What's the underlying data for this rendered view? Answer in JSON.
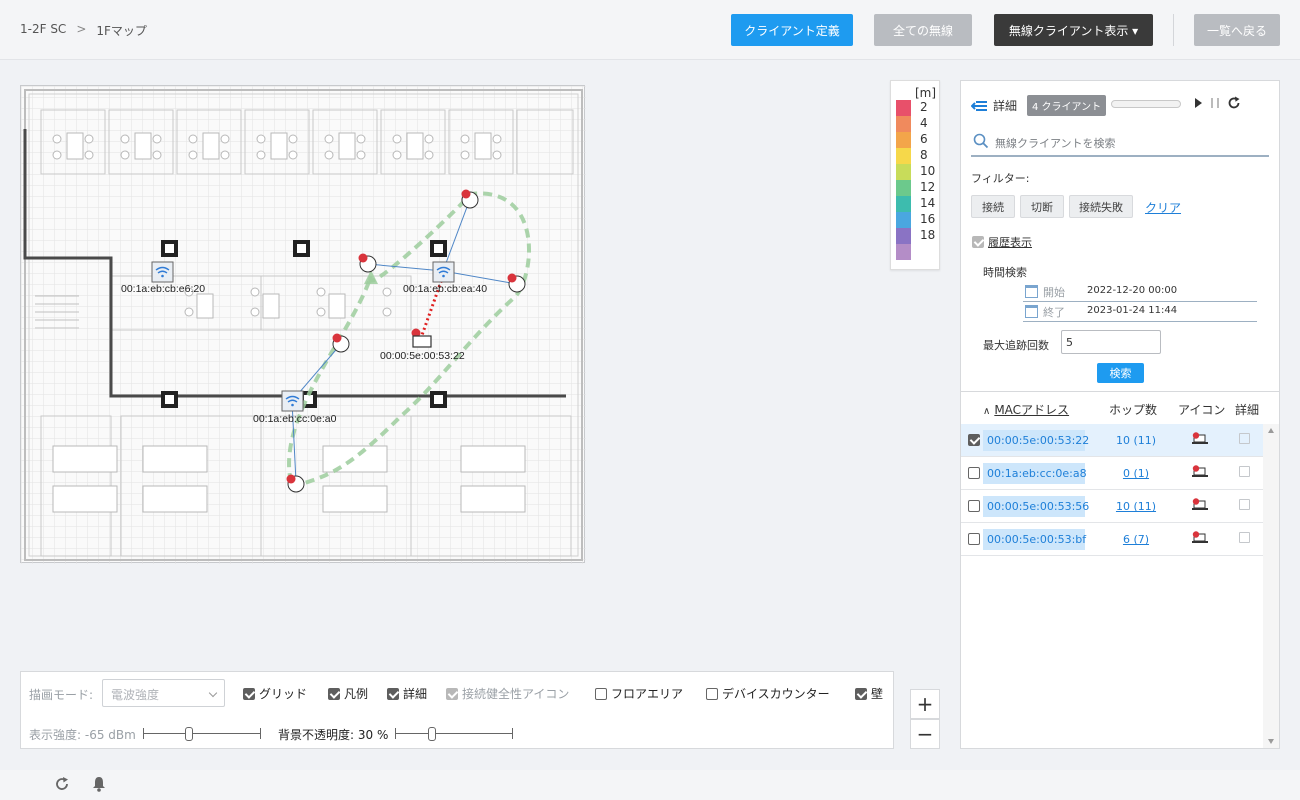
{
  "breadcrumb": {
    "root": "1-2F SC",
    "separator": ">",
    "current": "1Fマップ"
  },
  "header": {
    "define_client": "クライアント定義",
    "all_wireless": "全ての無線",
    "wireless_display": "無線クライアント表示 ▾",
    "back_to_list": "一覧へ戻る"
  },
  "legend": {
    "unit": "[m]",
    "items": [
      {
        "label": "2",
        "color": "#e8506a"
      },
      {
        "label": "4",
        "color": "#f08a5d"
      },
      {
        "label": "6",
        "color": "#f3a54a"
      },
      {
        "label": "8",
        "color": "#f6d84a"
      },
      {
        "label": "10",
        "color": "#c8dc5a"
      },
      {
        "label": "12",
        "color": "#6cc98c"
      },
      {
        "label": "14",
        "color": "#3dbcae"
      },
      {
        "label": "16",
        "color": "#4aa7e0"
      },
      {
        "label": "18",
        "color": "#8a73c4"
      },
      {
        "label": "",
        "color": "#b48dc7"
      }
    ]
  },
  "map": {
    "aps": [
      {
        "label": "00:1a:eb:cb:e6:20"
      },
      {
        "label": "00:1a:eb:cb:ea:40"
      },
      {
        "label": "00:1a:eb:cc:0e:a0"
      }
    ],
    "client_label": "00:00:5e:00:53:22"
  },
  "panel": {
    "detail": "詳細",
    "client_count": "4 クライアント",
    "search_placeholder": "無線クライアントを検索",
    "filter_label": "フィルター:",
    "filters": [
      "接続",
      "切断",
      "接続失敗"
    ],
    "clear": "クリア",
    "history": "履歴表示",
    "time_search": "時間検索",
    "start_label": "開始",
    "start_value": "2022-12-20 00:00",
    "end_label": "終了",
    "end_value": "2023-01-24 11:44",
    "max_trace_label": "最大追跡回数",
    "max_trace_value": "5",
    "search_button": "検索",
    "columns": {
      "mac": "MACアドレス",
      "hops": "ホップ数",
      "icon": "アイコン",
      "detail": "詳細"
    },
    "rows": [
      {
        "mac": "00:00:5e:00:53:22",
        "hops": "10 (11)",
        "checked": true
      },
      {
        "mac": "00:1a:eb:cc:0e:a8",
        "hops": "0 (1)",
        "checked": false
      },
      {
        "mac": "00:00:5e:00:53:56",
        "hops": "10 (11)",
        "checked": false
      },
      {
        "mac": "00:00:5e:00:53:bf",
        "hops": "6 (7)",
        "checked": false
      }
    ]
  },
  "toolbar": {
    "mode_label": "描画モード:",
    "mode_value": "電波強度",
    "grid": "グリッド",
    "legend": "凡例",
    "detail": "詳細",
    "health_icon": "接続健全性アイコン",
    "floor_area": "フロアエリア",
    "device_counter": "デバイスカウンター",
    "wall": "壁",
    "strength_label": "表示強度: -65 dBm",
    "strength_level": 0.38,
    "opacity_label": "背景不透明度: 30 %",
    "opacity_level": 0.3
  },
  "zoom": {
    "in": "+",
    "out": "−"
  }
}
